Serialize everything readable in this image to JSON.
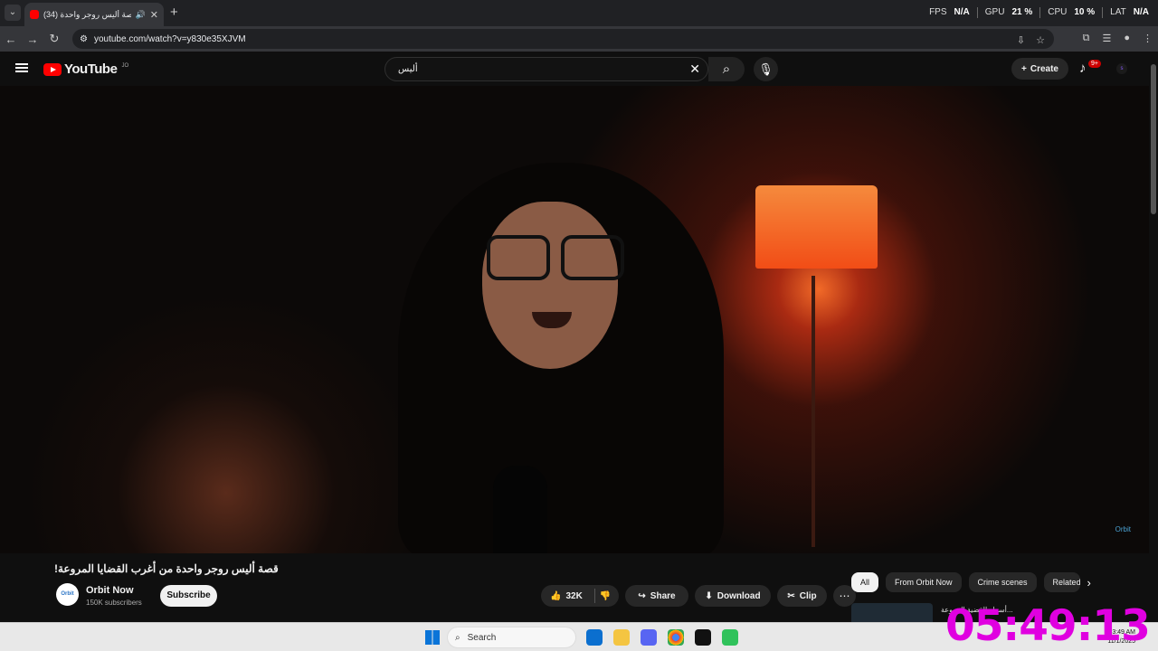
{
  "browser": {
    "tab_title": "(34) قصة أليس روجر واحدة ...",
    "url": "youtube.com/watch?v=y830e35XJVM",
    "perf": {
      "fps_label": "FPS",
      "fps_value": "N/A",
      "gpu_label": "GPU",
      "gpu_value": "21 %",
      "cpu_label": "CPU",
      "cpu_value": "10 %",
      "lat_label": "LAT",
      "lat_value": "N/A"
    }
  },
  "youtube": {
    "logo_text": "YouTube",
    "country_code": "JO",
    "search_value": "أليس",
    "create_label": "Create",
    "notification_count": "9+"
  },
  "video": {
    "title": "قصة أليس روجر واحدة من أغرب القضايا المروعة!",
    "watermark": "Orbit"
  },
  "channel": {
    "name": "Orbit Now",
    "subscribers": "150K subscribers",
    "subscribe_label": "Subscribe",
    "avatar_text": "Orbit"
  },
  "actions": {
    "likes": "32K",
    "share": "Share",
    "download": "Download",
    "clip": "Clip"
  },
  "chips": [
    "All",
    "From Orbit Now",
    "Crime scenes",
    "Related"
  ],
  "recommendation": {
    "title": "أسرار القضية المروعة..."
  },
  "taskbar": {
    "search_placeholder": "Search",
    "clock": "05:49:13",
    "tray_time": "3:49 AM",
    "tray_date": "11/1/2025"
  },
  "colors": {
    "youtube_red": "#ff0000",
    "overlay_clock": "#e000e0",
    "lamp_orange": "#f26a28"
  }
}
